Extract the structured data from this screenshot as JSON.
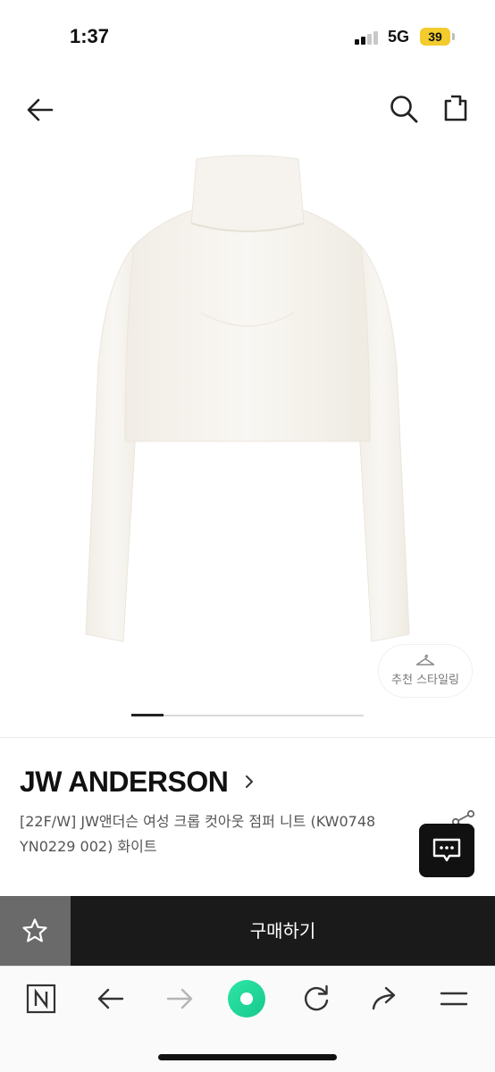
{
  "status_bar": {
    "time": "1:37",
    "network": "5G",
    "battery": "39",
    "battery_color": "#f2cb2c"
  },
  "header": {
    "back_icon": "arrow-left-icon",
    "search_icon": "search-icon",
    "share_icon": "share-icon"
  },
  "gallery": {
    "style_badge_label": "추천 스타일링",
    "style_badge_icon": "hanger-icon",
    "progress": 0.14
  },
  "product": {
    "brand": "JW ANDERSON",
    "title": "[22F/W] JW앤더슨 여성 크롭 컷아웃 점퍼 니트 (KW0748 YN0229 002) 화이트"
  },
  "buy_bar": {
    "wish_icon": "star-icon",
    "buy_label": "구매하기"
  },
  "browser_bar": {
    "icons": [
      "naver-n-icon",
      "back-arrow-icon",
      "forward-arrow-icon",
      "green-dot-icon",
      "reload-icon",
      "share-arrow-icon",
      "menu-icon"
    ],
    "accent_color": "#2ee6a6"
  }
}
